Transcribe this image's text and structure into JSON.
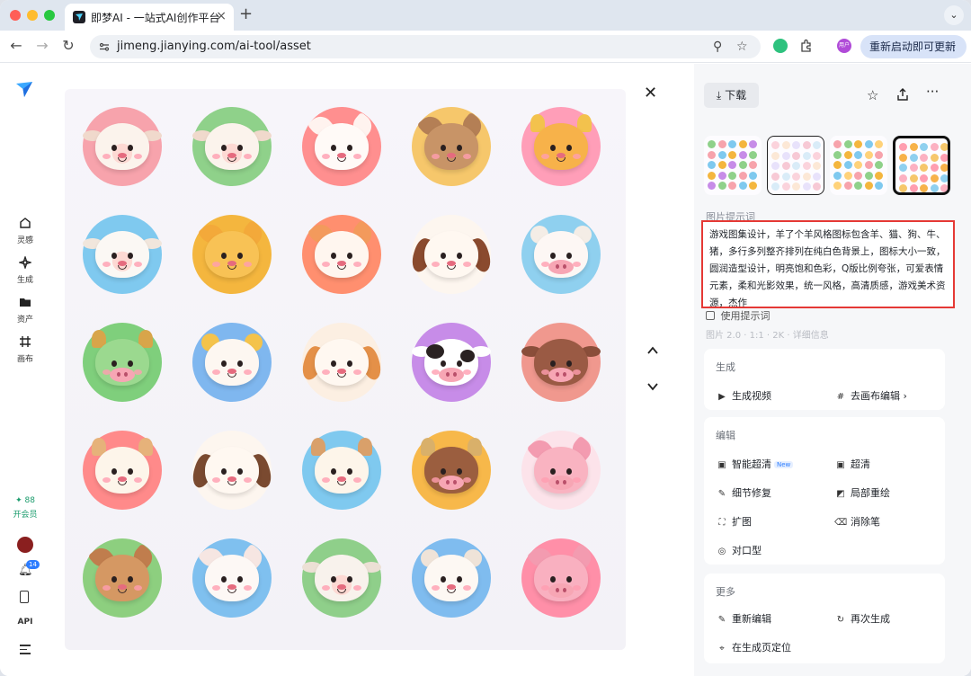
{
  "browser": {
    "tab_title": "即梦AI - 一站式AI创作平台",
    "tab_close": "×",
    "new_tab": "+",
    "url": "jimeng.jianying.com/ai-tool/asset",
    "update_button": "重新启动即可更新",
    "profile_label": "用户"
  },
  "sidebar": {
    "items": [
      {
        "label": "灵感",
        "icon": "home-icon"
      },
      {
        "label": "生成",
        "icon": "sparkle-icon"
      },
      {
        "label": "资产",
        "icon": "folder-icon"
      },
      {
        "label": "画布",
        "icon": "canvas-icon"
      }
    ],
    "credits": "✦ 88",
    "vip_label": "开会员",
    "notification_count": "14",
    "api_label": "API"
  },
  "panel": {
    "download_label": "下载",
    "prompt_section_label": "图片提示词",
    "prompt_text": "游戏图集设计，羊了个羊风格图标包含羊、猫、狗、牛、猪，多行多列整齐排列在纯白色背景上，图标大小一致，圆润造型设计，明亮饱和色彩，Q版比例夸张，可爱表情元素，柔和光影效果，统一风格，高清质感，游戏美术资源，杰作",
    "use_prompt_label": "使用提示词",
    "faded_meta": "图片 2.0 · 1:1 · 2K · 详细信息",
    "generate_section": {
      "title": "生成",
      "actions": [
        "生成视频",
        "去画布编辑 ›"
      ]
    },
    "edit_section": {
      "title": "编辑",
      "actions": [
        "智能超清",
        "超清",
        "细节修复",
        "局部重绘",
        "扩图",
        "消除笔",
        "对口型"
      ],
      "new_badge": "New"
    },
    "more_section": {
      "title": "更多",
      "actions": [
        "重新编辑",
        "再次生成",
        "在生成页定位"
      ]
    }
  },
  "colors": {
    "accent": "#2b7cff",
    "highlight_border": "#e53935",
    "vip_green": "#1a9b6c"
  }
}
